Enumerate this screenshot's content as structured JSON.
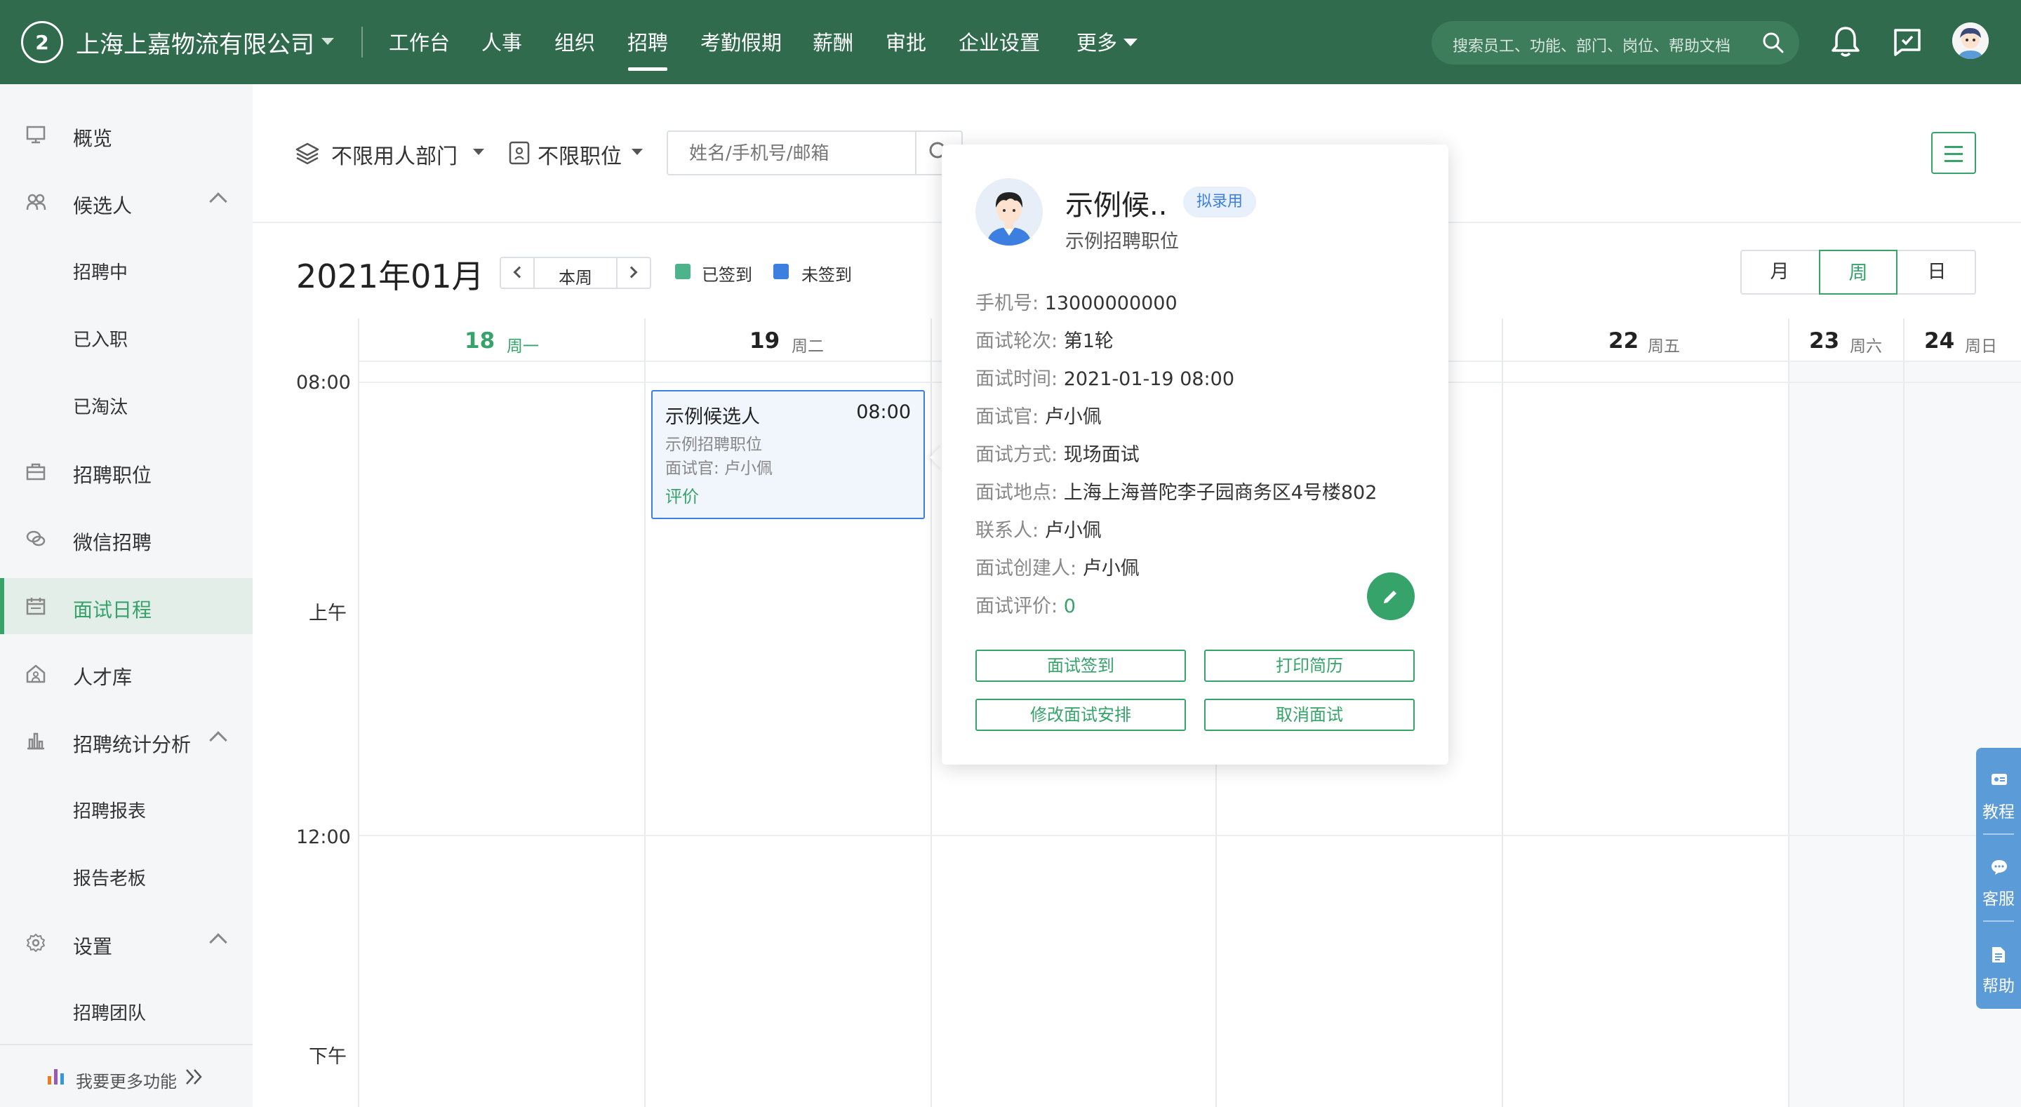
{
  "header": {
    "logo_text": "2",
    "company": "上海上嘉物流有限公司",
    "nav": [
      "工作台",
      "人事",
      "组织",
      "招聘",
      "考勤假期",
      "薪酬",
      "审批",
      "企业设置",
      "更多"
    ],
    "active_nav": "招聘",
    "search_placeholder": "搜索员工、功能、部门、岗位、帮助文档"
  },
  "sidebar": {
    "items": [
      {
        "label": "概览",
        "icon": "monitor-icon"
      },
      {
        "label": "候选人",
        "icon": "people-icon",
        "expanded": true
      },
      {
        "label": "招聘中",
        "sub": true
      },
      {
        "label": "已入职",
        "sub": true
      },
      {
        "label": "已淘汰",
        "sub": true
      },
      {
        "label": "招聘职位",
        "icon": "briefcase-icon"
      },
      {
        "label": "微信招聘",
        "icon": "wechat-icon"
      },
      {
        "label": "面试日程",
        "icon": "calendar-icon",
        "active": true
      },
      {
        "label": "人才库",
        "icon": "home-icon"
      },
      {
        "label": "招聘统计分析",
        "icon": "chart-icon",
        "expanded": true
      },
      {
        "label": "招聘报表",
        "sub": true
      },
      {
        "label": "报告老板",
        "sub": true
      },
      {
        "label": "设置",
        "icon": "gear-icon",
        "expanded": true
      },
      {
        "label": "招聘团队",
        "sub": true
      }
    ],
    "bottom": "我要更多功能"
  },
  "filters": {
    "department": "不限用人部门",
    "position": "不限职位",
    "search_placeholder": "姓名/手机号/邮箱"
  },
  "calendar": {
    "month": "2021年01月",
    "week_button": "本周",
    "legend": [
      {
        "label": "已签到",
        "color": "#4cb38b"
      },
      {
        "label": "未签到",
        "color": "#3d7fe0"
      }
    ],
    "views": [
      "月",
      "周",
      "日"
    ],
    "active_view": "周",
    "days": [
      {
        "num": "18",
        "weekday": "周一",
        "today": true
      },
      {
        "num": "19",
        "weekday": "周二"
      },
      {
        "num": "",
        "weekday": ""
      },
      {
        "num": "",
        "weekday": ""
      },
      {
        "num": "22",
        "weekday": "周五"
      },
      {
        "num": "23",
        "weekday": "周六"
      },
      {
        "num": "24",
        "weekday": "周日"
      }
    ],
    "time_labels": [
      "08:00",
      "上午",
      "12:00",
      "下午"
    ],
    "event": {
      "name": "示例候选人",
      "time": "08:00",
      "position": "示例招聘职位",
      "interviewer": "面试官: 卢小佩",
      "eval_link": "评价"
    }
  },
  "popover": {
    "name": "示例候..",
    "badge": "拟录用",
    "position": "示例招聘职位",
    "rows": [
      {
        "k": "手机号:",
        "v": "13000000000"
      },
      {
        "k": "面试轮次:",
        "v": "第1轮"
      },
      {
        "k": "面试时间:",
        "v": "2021-01-19 08:00"
      },
      {
        "k": "面试官:",
        "v": "卢小佩"
      },
      {
        "k": "面试方式:",
        "v": "现场面试"
      },
      {
        "k": "面试地点:",
        "v": "上海上海普陀李子园商务区4号楼802"
      },
      {
        "k": "联系人:",
        "v": "卢小佩"
      },
      {
        "k": "面试创建人:",
        "v": "卢小佩"
      },
      {
        "k": "面试评价:",
        "v": "0"
      }
    ],
    "buttons": [
      "面试签到",
      "打印简历",
      "修改面试安排",
      "取消面试"
    ]
  },
  "float_panel": [
    "教程",
    "客服",
    "帮助"
  ],
  "colors": {
    "brand": "#2f6b4c",
    "accent": "#36a36b",
    "event": "#3d7fe0"
  }
}
